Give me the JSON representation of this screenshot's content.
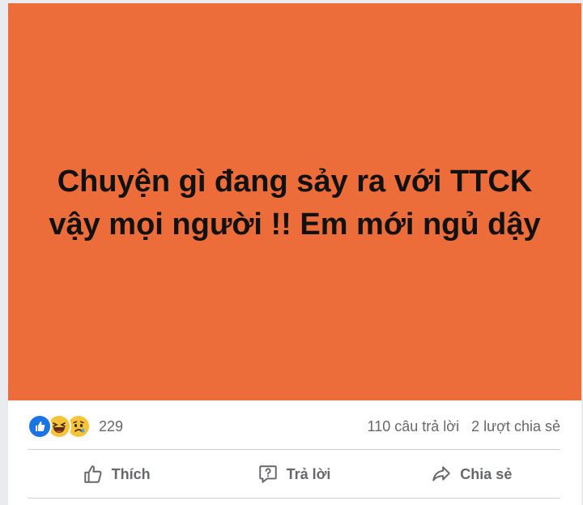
{
  "post": {
    "text": "Chuyện gì đang sảy ra với TTCK vậy mọi người !! Em mới ngủ dậy",
    "background_color": "#ec6c3a"
  },
  "reactions": {
    "icons": [
      "like-icon",
      "haha-icon",
      "sad-icon"
    ],
    "count": "229"
  },
  "stats": {
    "comments": "110 câu trả lời",
    "shares": "2 lượt chia sẻ"
  },
  "actions": {
    "like_label": "Thích",
    "reply_label": "Trả lời",
    "share_label": "Chia sẻ"
  }
}
